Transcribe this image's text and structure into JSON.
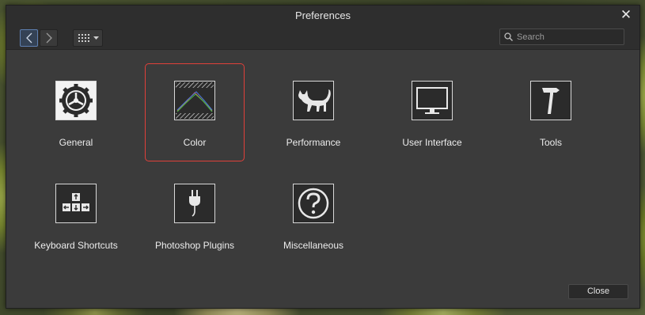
{
  "window": {
    "title": "Preferences"
  },
  "toolbar": {
    "search_placeholder": "Search"
  },
  "items": [
    {
      "label": "General",
      "icon": "gear-icon"
    },
    {
      "label": "Color",
      "icon": "color-graph-icon",
      "selected": true
    },
    {
      "label": "Performance",
      "icon": "cat-icon"
    },
    {
      "label": "User Interface",
      "icon": "monitor-icon"
    },
    {
      "label": "Tools",
      "icon": "hammer-icon"
    },
    {
      "label": "Keyboard Shortcuts",
      "icon": "keyboard-icon"
    },
    {
      "label": "Photoshop Plugins",
      "icon": "plug-icon"
    },
    {
      "label": "Miscellaneous",
      "icon": "question-icon"
    }
  ],
  "footer": {
    "close_label": "Close"
  },
  "colors": {
    "selection": "#e0403a",
    "window_bg": "#3b3b3b",
    "titlebar_bg": "#2e2e2e"
  }
}
